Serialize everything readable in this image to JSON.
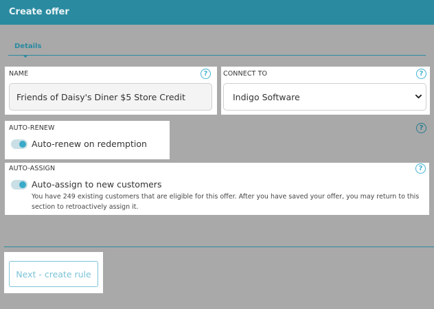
{
  "header": {
    "title": "Create offer"
  },
  "tabs": [
    {
      "label": "Details",
      "active": true
    }
  ],
  "name": {
    "label": "NAME",
    "value": "Friends of Daisy's Diner $5 Store Credit",
    "help_icon": "?"
  },
  "connect_to": {
    "label": "CONNECT TO",
    "selected": "Indigo Software",
    "help_icon": "?"
  },
  "auto_renew": {
    "label": "AUTO-RENEW",
    "toggle_label": "Auto-renew on redemption",
    "enabled": true,
    "help_icon": "?"
  },
  "auto_assign": {
    "label": "AUTO-ASSIGN",
    "toggle_label": "Auto-assign to new customers",
    "enabled": true,
    "description_line1": "You have 249 existing customers that are eligible for this offer. After you have saved your offer, you may return to this",
    "description_line2": "section to retroactively assign it.",
    "help_icon": "?"
  },
  "footer": {
    "next_button": "Next - create rule"
  },
  "colors": {
    "accent": "#2a8aa0",
    "toggle_on": "#3aaac8",
    "background": "#a9a9a9"
  }
}
